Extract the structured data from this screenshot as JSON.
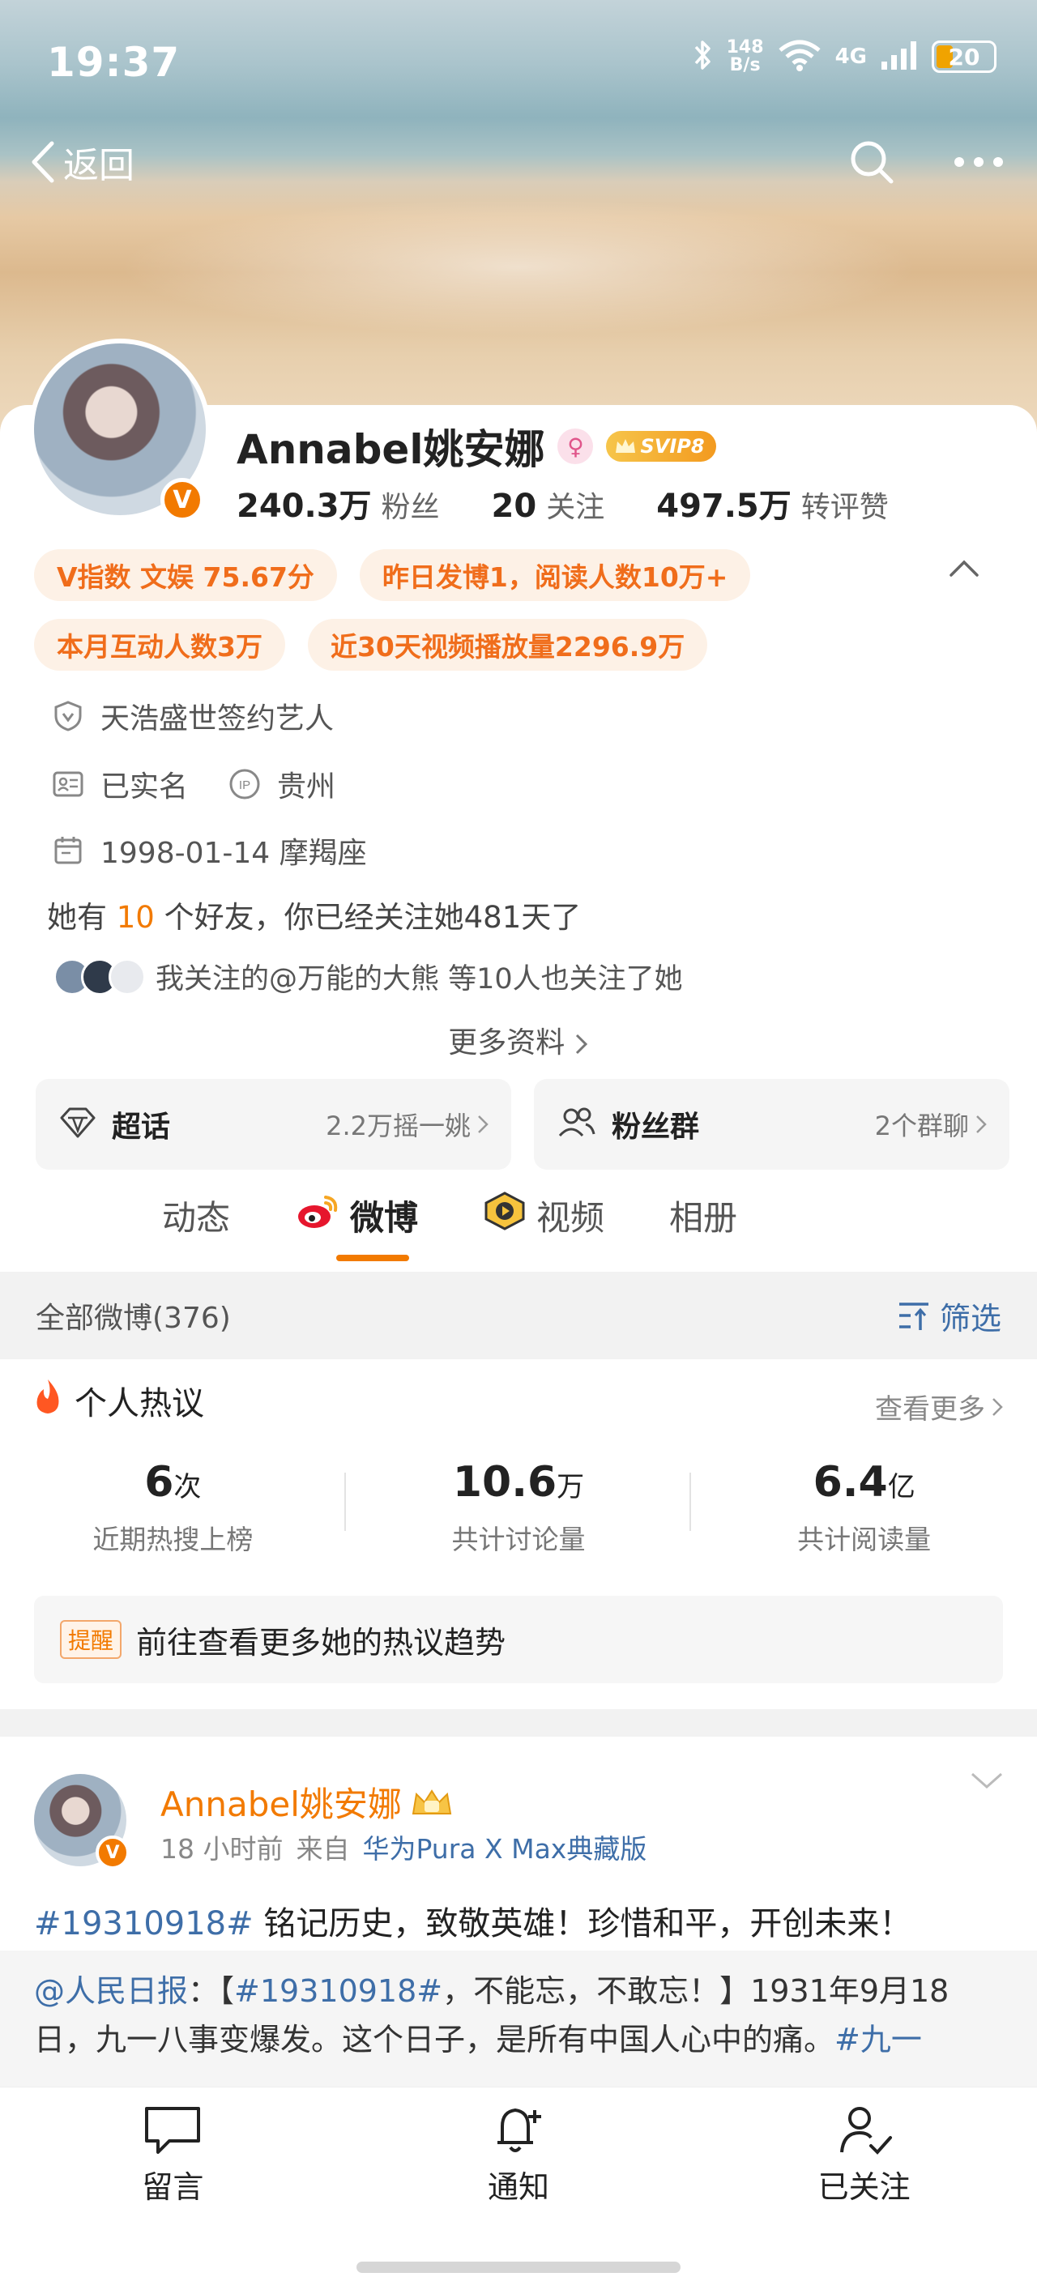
{
  "status": {
    "time": "19:37",
    "net_speed_top": "148",
    "net_speed_bottom": "B/s",
    "network": "4G",
    "battery": "20"
  },
  "nav": {
    "back_label": "返回"
  },
  "profile": {
    "name": "Annabel姚安娜",
    "vip_label": "SVIP8",
    "verified_badge": "V",
    "stats": [
      {
        "num": "240.3万",
        "label": "粉丝"
      },
      {
        "num": "20",
        "label": "关注"
      },
      {
        "num": "497.5万",
        "label": "转评赞"
      }
    ],
    "chips_row1": [
      "V指数 文娱 75.67分",
      "昨日发博1，阅读人数10万+"
    ],
    "chips_row2": [
      "本月互动人数3万",
      "近30天视频播放量2296.9万"
    ],
    "company": "天浩盛世签约艺人",
    "real_name": "已实名",
    "ip_badge": "IP",
    "location": "贵州",
    "birthday": "1998-01-14 摩羯座",
    "friends_prefix": "她有",
    "friends_count": "10",
    "friends_suffix": "个好友，你已经关注她481天了",
    "mutual": "我关注的@万能的大熊 等10人也关注了她",
    "more_info": "更多资料"
  },
  "tiles": [
    {
      "title": "超话",
      "sub": "2.2万摇一姚"
    },
    {
      "title": "粉丝群",
      "sub": "2个群聊"
    }
  ],
  "tabs": [
    "动态",
    "微博",
    "视频",
    "相册"
  ],
  "feed": {
    "all_label": "全部微博(376)",
    "filter_label": "筛选"
  },
  "hot": {
    "title": "个人热议",
    "see_more": "查看更多",
    "stats": [
      {
        "value": "6",
        "unit": "次",
        "label": "近期热搜上榜"
      },
      {
        "value": "10.6",
        "unit": "万",
        "label": "共计讨论量"
      },
      {
        "value": "6.4",
        "unit": "亿",
        "label": "共计阅读量"
      }
    ],
    "remind_tag": "提醒",
    "remind_text": "前往查看更多她的热议趋势"
  },
  "post": {
    "author": "Annabel姚安娜",
    "time": "18 小时前",
    "from": "来自",
    "source": "华为Pura X Max典藏版",
    "topic": "#19310918#",
    "text": " 铭记历史，致敬英雄！珍惜和平，开创未来！",
    "repost_author": "@人民日报",
    "repost_sep": "：【",
    "repost_topic": "#19310918#",
    "repost_text": "，不能忘，不敢忘！】1931年9月18日，九一八事变爆发。这个日子，是所有中国人心中的痛。",
    "repost_tail": "#九一"
  },
  "bottom": {
    "comment": "留言",
    "notify": "通知",
    "followed": "已关注"
  },
  "colors": {
    "accent": "#f27a00",
    "link": "#3e6ea8",
    "chip_bg": "#fdf1e6"
  }
}
